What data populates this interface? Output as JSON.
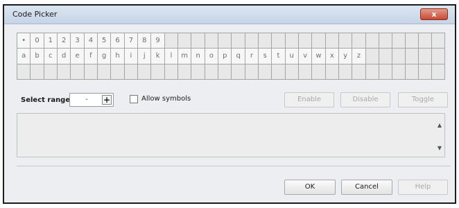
{
  "window": {
    "title": "Code Picker",
    "close_label": "x"
  },
  "grid": {
    "rows": [
      [
        "•",
        "0",
        "1",
        "2",
        "3",
        "4",
        "5",
        "6",
        "7",
        "8",
        "9",
        "",
        "",
        "",
        "",
        "",
        "",
        "",
        "",
        "",
        "",
        "",
        "",
        "",
        "",
        "",
        "",
        "",
        "",
        "",
        "",
        ""
      ],
      [
        "a",
        "b",
        "c",
        "d",
        "e",
        "f",
        "g",
        "h",
        "i",
        "j",
        "k",
        "l",
        "m",
        "n",
        "o",
        "p",
        "q",
        "r",
        "s",
        "t",
        "u",
        "v",
        "w",
        "x",
        "y",
        "z",
        "",
        "",
        "",
        "",
        "",
        ""
      ],
      [
        "",
        "",
        "",
        "",
        "",
        "",
        "",
        "",
        "",
        "",
        "",
        "",
        "",
        "",
        "",
        "",
        "",
        "",
        "",
        "",
        "",
        "",
        "",
        "",
        "",
        "",
        "",
        "",
        "",
        "",
        "",
        ""
      ]
    ]
  },
  "controls": {
    "select_range_label": "Select range:",
    "range_value": "-",
    "range_plus": "+",
    "allow_symbols_label": "Allow symbols",
    "allow_symbols_checked": false,
    "enable_label": "Enable",
    "disable_label": "Disable",
    "toggle_label": "Toggle"
  },
  "footer": {
    "ok_label": "OK",
    "cancel_label": "Cancel",
    "help_label": "Help"
  },
  "colors": {
    "close_button": "#c84a36",
    "titlebar": "#c6d4e6"
  }
}
